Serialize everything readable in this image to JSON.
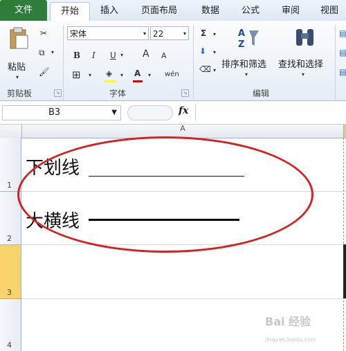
{
  "tabs": [
    "文件",
    "开始",
    "插入",
    "页面布局",
    "数据",
    "公式",
    "审阅",
    "视图"
  ],
  "clipboard": {
    "paste": "粘贴",
    "label": "剪贴板"
  },
  "font": {
    "name": "宋体",
    "size": "22",
    "label": "字体",
    "bold": "B",
    "italic": "I",
    "underline": "U",
    "grow": "A",
    "shrink": "A",
    "phonetic": "wén"
  },
  "editing": {
    "sort": "排序和筛选",
    "find": "查找和选择",
    "label": "编辑",
    "sigma": "Σ"
  },
  "formula_bar": {
    "namebox": "B3",
    "fx": "fx"
  },
  "grid": {
    "column_a": "A",
    "rows": [
      "1",
      "2",
      "3",
      "4"
    ],
    "cells": {
      "a1": "下划线",
      "a2": "大横线"
    }
  },
  "watermark": {
    "line1": "Bai 经验",
    "line2": "jingyan.baidu.com"
  }
}
